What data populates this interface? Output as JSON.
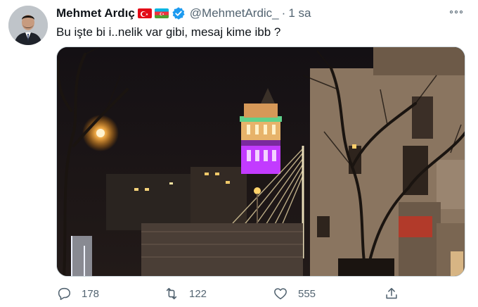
{
  "tweet": {
    "author_name": "Mehmet Ardıç",
    "handle": "@MehmetArdic_",
    "separator": "·",
    "time": "1 sa",
    "text": "Bu işte bi i..nelik var gibi, mesaj kime ibb ?",
    "flags": [
      "turkey-flag-icon",
      "azerbaijan-flag-icon"
    ],
    "verified_icon": "verified-badge-icon"
  },
  "actions": {
    "replies": "178",
    "retweets": "122",
    "likes": "555"
  },
  "colors": {
    "text": "#0f1419",
    "secondary": "#536471",
    "verified": "#1d9bf0",
    "tower_light": "#c23bff"
  }
}
